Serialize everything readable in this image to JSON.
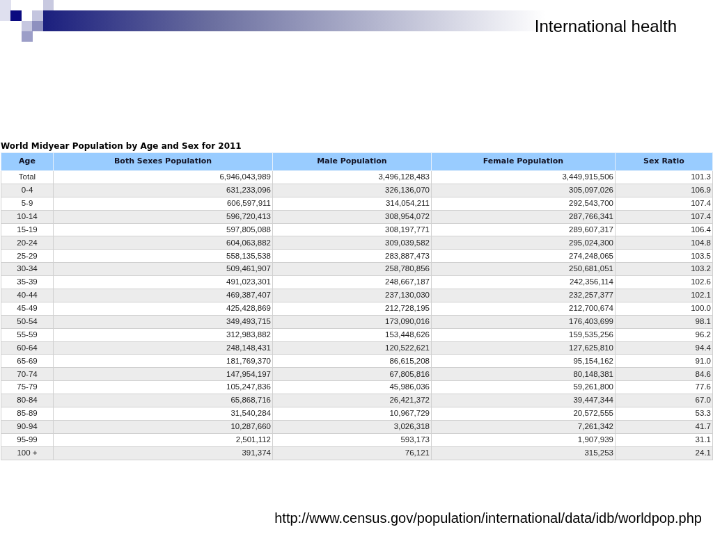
{
  "slide": {
    "title": "International health",
    "source_url": "http://www.census.gov/population/international/data/idb/worldpop.php"
  },
  "table": {
    "caption": "World Midyear Population by Age and Sex for 2011",
    "columns": [
      "Age",
      "Both Sexes Population",
      "Male Population",
      "Female Population",
      "Sex Ratio"
    ],
    "rows": [
      [
        "Total",
        "6,946,043,989",
        "3,496,128,483",
        "3,449,915,506",
        "101.3"
      ],
      [
        "0-4",
        "631,233,096",
        "326,136,070",
        "305,097,026",
        "106.9"
      ],
      [
        "5-9",
        "606,597,911",
        "314,054,211",
        "292,543,700",
        "107.4"
      ],
      [
        "10-14",
        "596,720,413",
        "308,954,072",
        "287,766,341",
        "107.4"
      ],
      [
        "15-19",
        "597,805,088",
        "308,197,771",
        "289,607,317",
        "106.4"
      ],
      [
        "20-24",
        "604,063,882",
        "309,039,582",
        "295,024,300",
        "104.8"
      ],
      [
        "25-29",
        "558,135,538",
        "283,887,473",
        "274,248,065",
        "103.5"
      ],
      [
        "30-34",
        "509,461,907",
        "258,780,856",
        "250,681,051",
        "103.2"
      ],
      [
        "35-39",
        "491,023,301",
        "248,667,187",
        "242,356,114",
        "102.6"
      ],
      [
        "40-44",
        "469,387,407",
        "237,130,030",
        "232,257,377",
        "102.1"
      ],
      [
        "45-49",
        "425,428,869",
        "212,728,195",
        "212,700,674",
        "100.0"
      ],
      [
        "50-54",
        "349,493,715",
        "173,090,016",
        "176,403,699",
        "98.1"
      ],
      [
        "55-59",
        "312,983,882",
        "153,448,626",
        "159,535,256",
        "96.2"
      ],
      [
        "60-64",
        "248,148,431",
        "120,522,621",
        "127,625,810",
        "94.4"
      ],
      [
        "65-69",
        "181,769,370",
        "86,615,208",
        "95,154,162",
        "91.0"
      ],
      [
        "70-74",
        "147,954,197",
        "67,805,816",
        "80,148,381",
        "84.6"
      ],
      [
        "75-79",
        "105,247,836",
        "45,986,036",
        "59,261,800",
        "77.6"
      ],
      [
        "80-84",
        "65,868,716",
        "26,421,372",
        "39,447,344",
        "67.0"
      ],
      [
        "85-89",
        "31,540,284",
        "10,967,729",
        "20,572,555",
        "53.3"
      ],
      [
        "90-94",
        "10,287,660",
        "3,026,318",
        "7,261,342",
        "41.7"
      ],
      [
        "95-99",
        "2,501,112",
        "593,173",
        "1,907,939",
        "31.1"
      ],
      [
        "100 +",
        "391,374",
        "76,121",
        "315,253",
        "24.1"
      ]
    ]
  }
}
